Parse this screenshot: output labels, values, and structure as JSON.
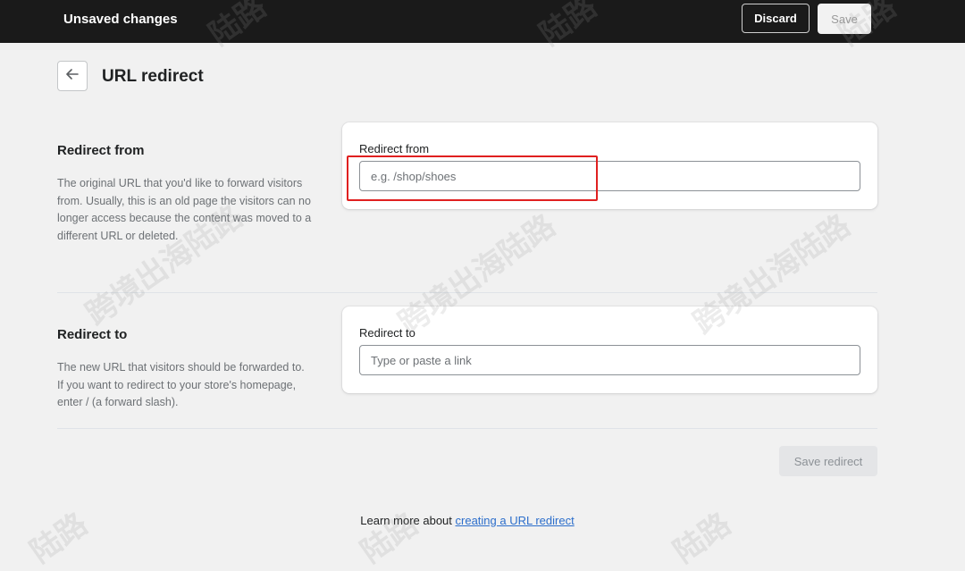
{
  "header": {
    "title": "Unsaved changes",
    "discard_label": "Discard",
    "save_label": "Save"
  },
  "page": {
    "title": "URL redirect",
    "back_icon": "arrow-left-icon"
  },
  "redirect_from": {
    "section_title": "Redirect from",
    "description": "The original URL that you'd like to forward visitors from. Usually, this is an old page the visitors can no longer access because the content was moved to a different URL or deleted.",
    "field_label": "Redirect from",
    "placeholder": "e.g. /shop/shoes",
    "value": ""
  },
  "redirect_to": {
    "section_title": "Redirect to",
    "description": "The new URL that visitors should be forwarded to. If you want to redirect to your store's homepage, enter / (a forward slash).",
    "field_label": "Redirect to",
    "placeholder": "Type or paste a link",
    "value": ""
  },
  "actions": {
    "save_redirect_label": "Save redirect"
  },
  "footer": {
    "prefix": "Learn more about ",
    "link_text": "creating a URL redirect"
  },
  "watermark": {
    "text": "跨境出海陆路",
    "fragment": "陆路"
  },
  "colors": {
    "topbar": "#1a1a1a",
    "background": "#f1f1f1",
    "link": "#2c6ecb",
    "highlight": "#e02020"
  }
}
